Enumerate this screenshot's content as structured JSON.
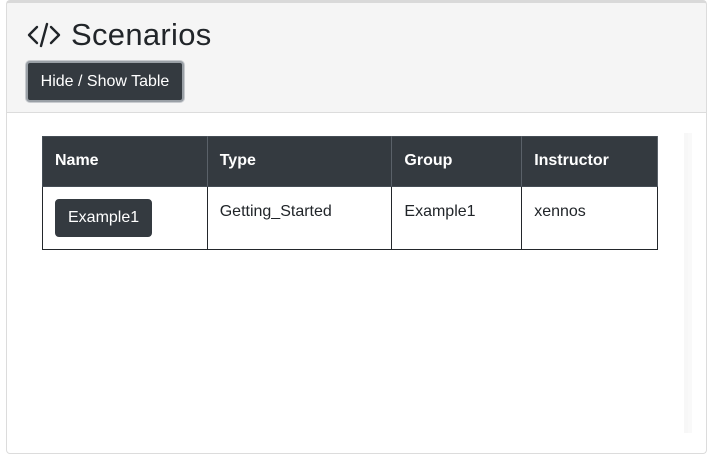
{
  "header": {
    "title": "Scenarios",
    "icon": "code-icon",
    "toggle_label": "Hide / Show Table"
  },
  "table": {
    "columns": [
      "Name",
      "Type",
      "Group",
      "Instructor"
    ],
    "rows": [
      {
        "name": "Example1",
        "type": "Getting_Started",
        "group": "Example1",
        "instructor": "xennos"
      }
    ]
  },
  "colors": {
    "dark": "#343a40",
    "header_bg": "#f5f5f5"
  }
}
